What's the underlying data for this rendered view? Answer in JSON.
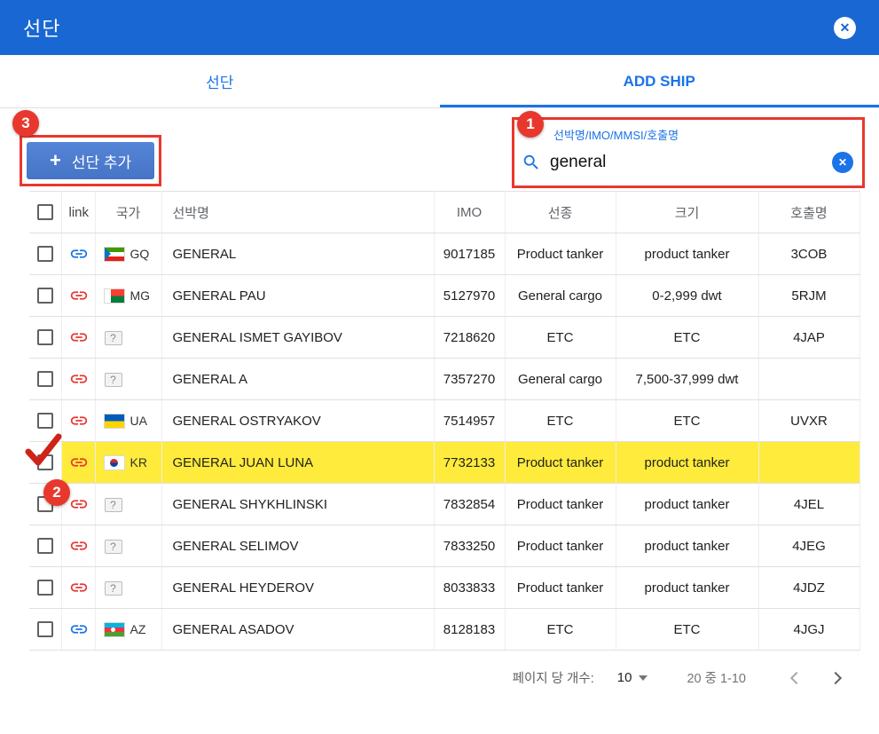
{
  "colors": {
    "header_blue": "#1967d2",
    "accent_blue": "#1a73e8",
    "annotation_red": "#e8382e",
    "link_red": "#e53935",
    "highlight_yellow": "#ffeb3b"
  },
  "dialog": {
    "title": "선단"
  },
  "tabs": {
    "fleet": "선단",
    "add_ship": "ADD SHIP"
  },
  "toolbar": {
    "plus": "+",
    "add_button": "선단 추가"
  },
  "search": {
    "label": "선박명/IMO/MMSI/호출명",
    "value": "general"
  },
  "annotations": {
    "step1": "1",
    "step2": "2",
    "step3": "3"
  },
  "table": {
    "headers": {
      "link": "link",
      "country": "국가",
      "name": "선박명",
      "imo": "IMO",
      "type": "선종",
      "size": "크기",
      "callsign": "호출명"
    },
    "rows": [
      {
        "link": "blue",
        "flag": "GQ",
        "name": "GENERAL",
        "imo": "9017185",
        "type": "Product tanker",
        "size": "product tanker",
        "callsign": "3COB",
        "highlight": false
      },
      {
        "link": "red",
        "flag": "MG",
        "name": "GENERAL PAU",
        "imo": "5127970",
        "type": "General cargo",
        "size": "0-2,999 dwt",
        "callsign": "5RJM",
        "highlight": false
      },
      {
        "link": "red",
        "flag": "?",
        "name": "GENERAL ISMET GAYIBOV",
        "imo": "7218620",
        "type": "ETC",
        "size": "ETC",
        "callsign": "4JAP",
        "highlight": false
      },
      {
        "link": "red",
        "flag": "?",
        "name": "GENERAL A",
        "imo": "7357270",
        "type": "General cargo",
        "size": "7,500-37,999 dwt",
        "callsign": "",
        "highlight": false
      },
      {
        "link": "red",
        "flag": "UA",
        "name": "GENERAL OSTRYAKOV",
        "imo": "7514957",
        "type": "ETC",
        "size": "ETC",
        "callsign": "UVXR",
        "highlight": false
      },
      {
        "link": "red",
        "flag": "KR",
        "name": "GENERAL JUAN LUNA",
        "imo": "7732133",
        "type": "Product tanker",
        "size": "product tanker",
        "callsign": "",
        "highlight": true
      },
      {
        "link": "red",
        "flag": "?",
        "name": "GENERAL SHYKHLINSKI",
        "imo": "7832854",
        "type": "Product tanker",
        "size": "product tanker",
        "callsign": "4JEL",
        "highlight": false
      },
      {
        "link": "red",
        "flag": "?",
        "name": "GENERAL SELIMOV",
        "imo": "7833250",
        "type": "Product tanker",
        "size": "product tanker",
        "callsign": "4JEG",
        "highlight": false
      },
      {
        "link": "red",
        "flag": "?",
        "name": "GENERAL HEYDEROV",
        "imo": "8033833",
        "type": "Product tanker",
        "size": "product tanker",
        "callsign": "4JDZ",
        "highlight": false
      },
      {
        "link": "blue",
        "flag": "AZ",
        "name": "GENERAL ASADOV",
        "imo": "8128183",
        "type": "ETC",
        "size": "ETC",
        "callsign": "4JGJ",
        "highlight": false
      }
    ]
  },
  "pagination": {
    "per_page_label": "페이지 당 개수:",
    "per_page_value": "10",
    "range": "20 중 1-10"
  }
}
